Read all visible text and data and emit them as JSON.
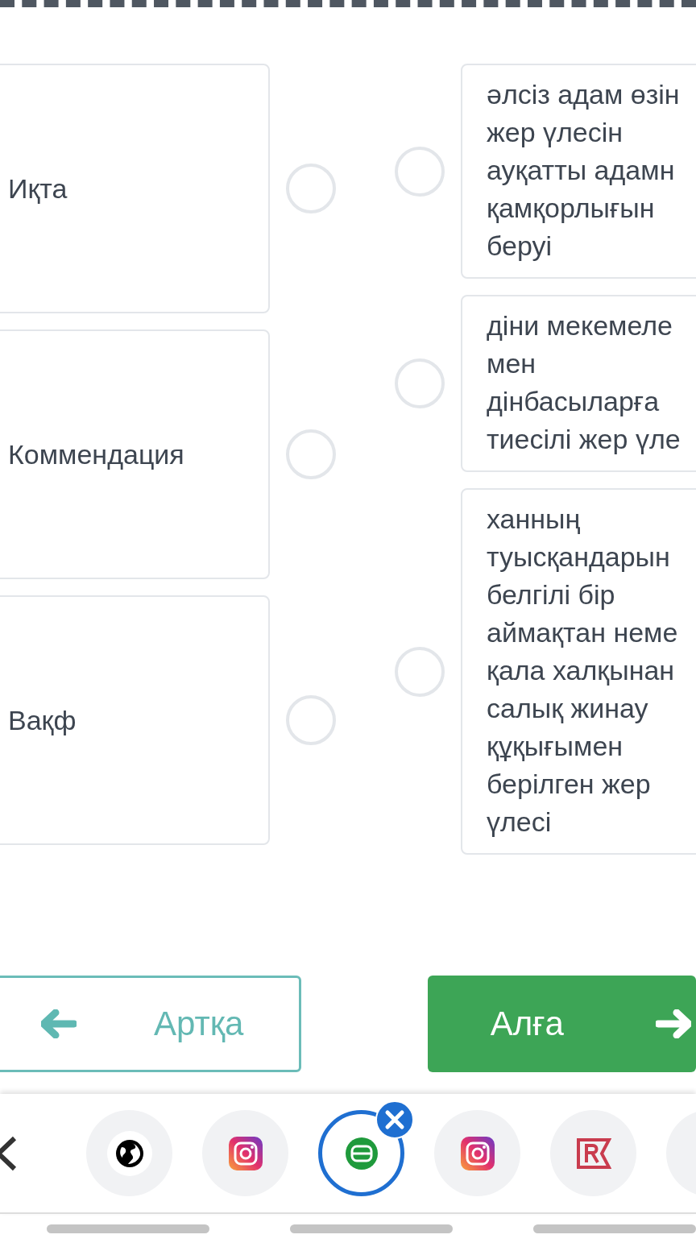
{
  "left_items": [
    {
      "label": "Иқта"
    },
    {
      "label": "Коммендация"
    },
    {
      "label": "Вақф"
    }
  ],
  "right_items": [
    {
      "lines": [
        "әлсіз адам өзін",
        "жер үлесін",
        "ауқатты адамн",
        "қамқорлығын",
        "беруі"
      ]
    },
    {
      "lines": [
        "діни мекемеле",
        "мен",
        "дінбасыларға",
        "тиесілі жер үле"
      ]
    },
    {
      "lines": [
        "ханның",
        "туысқандарын",
        "белгілі бір",
        "аймақтан неме",
        "қала халқынан",
        "салық жинау",
        "құқығымен",
        "берілген жер",
        "үлесі"
      ]
    }
  ],
  "nav": {
    "back": "Артқа",
    "next": "Алға"
  },
  "app_switcher": [
    {
      "kind": "globe",
      "selected": false
    },
    {
      "kind": "instagram",
      "selected": false
    },
    {
      "kind": "b-app",
      "selected": true
    },
    {
      "kind": "instagram",
      "selected": false
    },
    {
      "kind": "r-app",
      "selected": false
    },
    {
      "kind": "partial",
      "selected": false
    }
  ]
}
